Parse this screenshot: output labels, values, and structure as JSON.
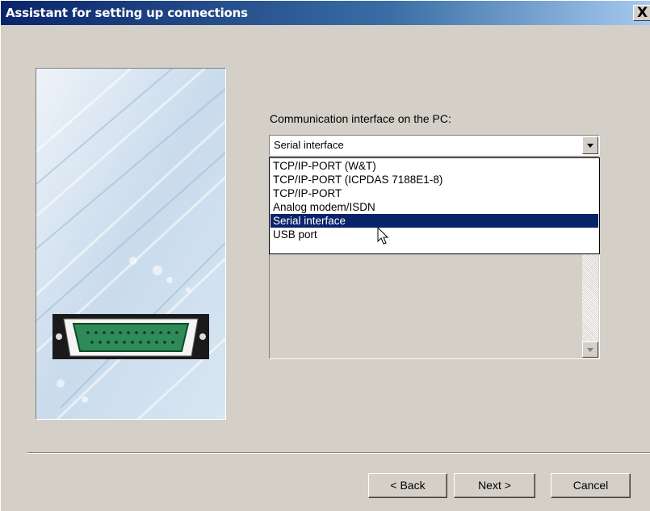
{
  "window": {
    "title": "Assistant for setting up connections",
    "close_label": "X"
  },
  "main": {
    "label": "Communication interface on the PC:",
    "combo_value": "Serial interface",
    "options": [
      "TCP/IP-PORT (W&T)",
      "TCP/IP-PORT (ICPDAS 7188E1-8)",
      "TCP/IP-PORT",
      "Analog modem/ISDN",
      "Serial interface",
      "USB port"
    ],
    "selected_option": "Serial interface"
  },
  "buttons": {
    "back": "< Back",
    "next": "Next >",
    "cancel": "Cancel"
  },
  "colors": {
    "title_bar_start": "#0a246a",
    "selection": "#0a246a",
    "dialog_face": "#d4d0c8",
    "connector_green": "#2e8b57"
  }
}
